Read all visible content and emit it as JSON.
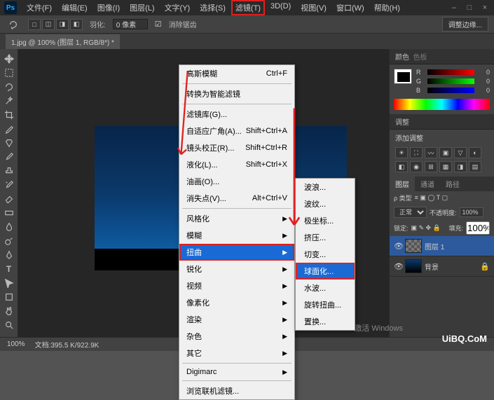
{
  "menubar": {
    "items": [
      {
        "label": "文件(F)"
      },
      {
        "label": "编辑(E)"
      },
      {
        "label": "图像(I)"
      },
      {
        "label": "图层(L)"
      },
      {
        "label": "文字(Y)"
      },
      {
        "label": "选择(S)"
      },
      {
        "label": "滤镜(T)"
      },
      {
        "label": "3D(D)"
      },
      {
        "label": "视图(V)"
      },
      {
        "label": "窗口(W)"
      },
      {
        "label": "帮助(H)"
      }
    ]
  },
  "options": {
    "feather_label": "羽化:",
    "feather_value": "0 像素",
    "antialias_label": "消除锯齿",
    "adjust_edge": "调整边缘..."
  },
  "document_tab": "1.jpg @ 100% (图层 1, RGB/8*) *",
  "filter_menu": {
    "last_filter": {
      "label": "高斯模糊",
      "shortcut": "Ctrl+F"
    },
    "convert_smart": "转换为智能滤镜",
    "filter_gallery": "滤镜库(G)...",
    "adaptive_wide": {
      "label": "自适应广角(A)...",
      "shortcut": "Shift+Ctrl+A"
    },
    "lens_correct": {
      "label": "镜头校正(R)...",
      "shortcut": "Shift+Ctrl+R"
    },
    "liquify": {
      "label": "液化(L)...",
      "shortcut": "Shift+Ctrl+X"
    },
    "oil_paint": "油画(O)...",
    "vanishing": {
      "label": "消失点(V)...",
      "shortcut": "Alt+Ctrl+V"
    },
    "stylize": "风格化",
    "blur": "模糊",
    "distort": "扭曲",
    "sharpen": "锐化",
    "video": "视频",
    "pixelate": "像素化",
    "render": "渲染",
    "noise": "杂色",
    "other": "其它",
    "digimarc": "Digimarc",
    "browse_online": "浏览联机滤镜..."
  },
  "distort_submenu": {
    "items": [
      "波浪...",
      "波纹...",
      "极坐标...",
      "挤压...",
      "切变...",
      "球面化...",
      "水波...",
      "旋转扭曲...",
      "置换..."
    ]
  },
  "color_panel": {
    "tab": "颜色",
    "tab2": "色板",
    "r": "R",
    "r_val": "0",
    "g": "G",
    "g_val": "0",
    "b": "B",
    "b_val": "0"
  },
  "adjustments_panel": {
    "tab": "调整",
    "title": "添加调整"
  },
  "layers_panel": {
    "tabs": [
      "图层",
      "通道",
      "路径"
    ],
    "kind_label": "ρ 类型",
    "mode": "正常",
    "opacity_label": "不透明度:",
    "opacity_value": "100%",
    "lock_label": "锁定:",
    "fill_label": "填充:",
    "fill_value": "100%",
    "layers": [
      {
        "name": "图层 1"
      },
      {
        "name": "背景"
      }
    ]
  },
  "statusbar": {
    "zoom": "100%",
    "doc_info": "文档:395.5 K/922.9K"
  },
  "watermark": {
    "activate": "激活 Windows",
    "brand": "UiBQ.CoM"
  }
}
